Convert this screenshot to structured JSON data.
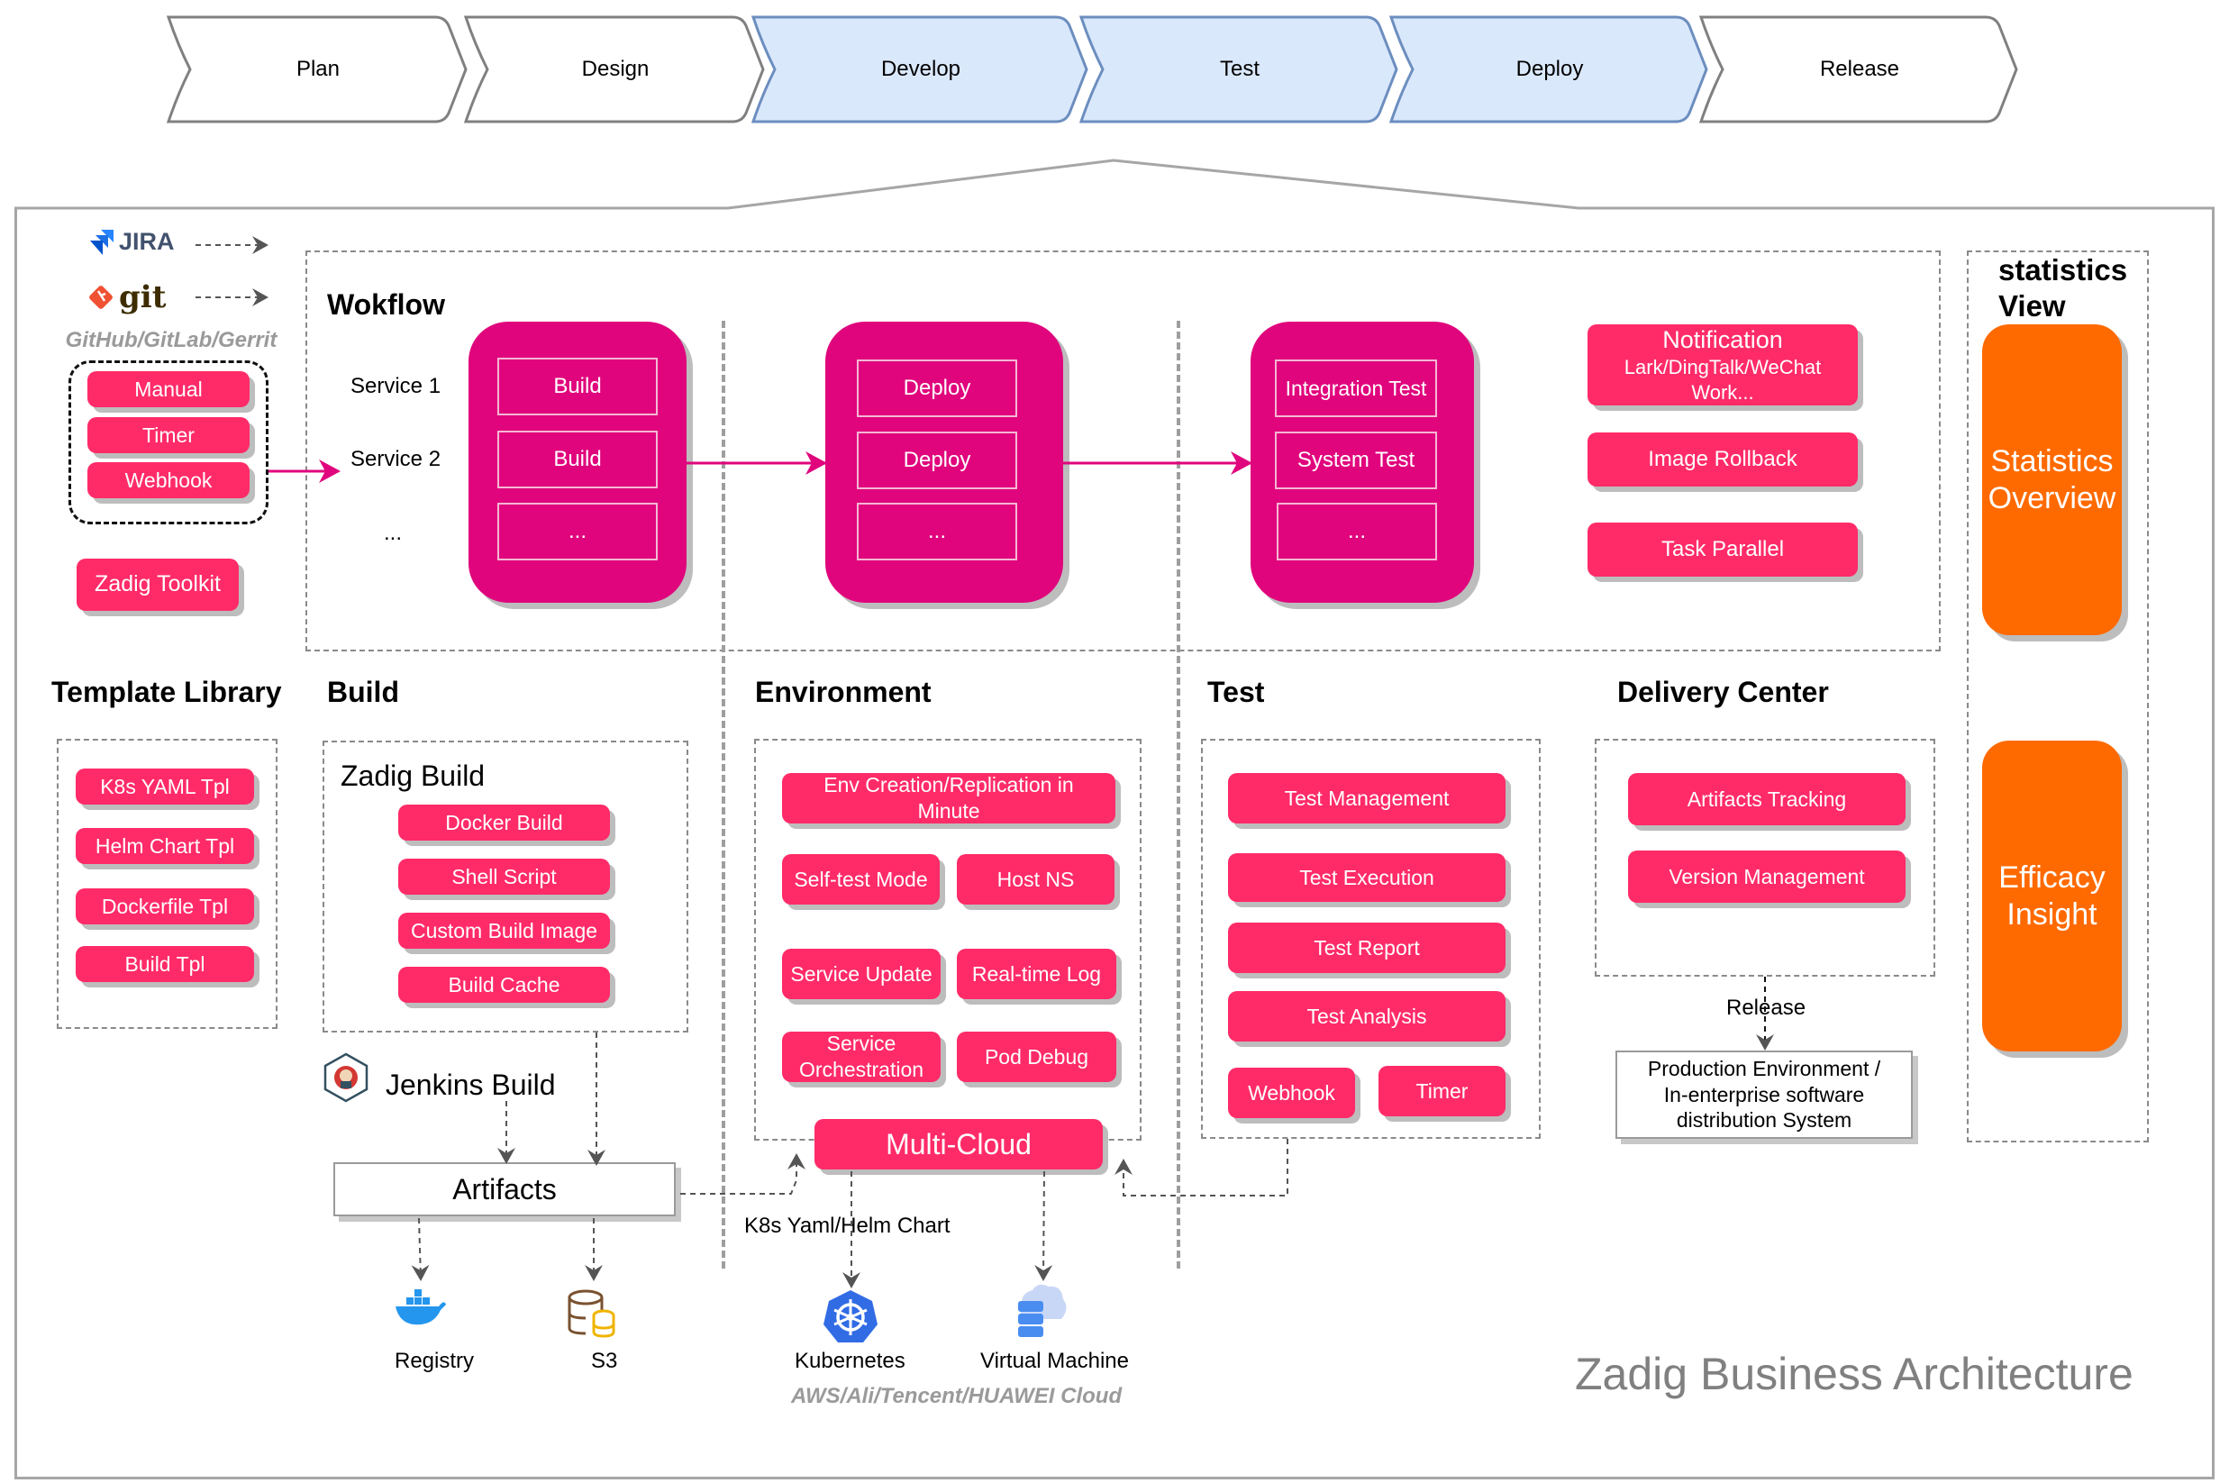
{
  "lifecycle": {
    "stages": [
      {
        "label": "Plan",
        "active": false
      },
      {
        "label": "Design",
        "active": false
      },
      {
        "label": "Develop",
        "active": true
      },
      {
        "label": "Test",
        "active": true
      },
      {
        "label": "Deploy",
        "active": true
      },
      {
        "label": "Release",
        "active": false
      }
    ],
    "active_fill": "#dae8fc",
    "active_stroke": "#6c8ebf",
    "inactive_stroke": "#808080"
  },
  "sources": {
    "jira_label": "JIRA",
    "git_label": "git",
    "git_hosts": "GitHub/GitLab/Gerrit"
  },
  "triggers": [
    "Manual",
    "Timer",
    "Webhook"
  ],
  "toolkit": "Zadig Toolkit",
  "workflow": {
    "title": "Wokflow",
    "services": [
      "Service 1",
      "Service 2",
      "..."
    ],
    "build_stage": [
      "Build",
      "Build",
      "..."
    ],
    "deploy_stage": [
      "Deploy",
      "Deploy",
      "..."
    ],
    "test_stage": [
      "Integration Test",
      "System Test",
      "..."
    ],
    "extras": {
      "notification_title": "Notification",
      "notification_sub": "Lark/DingTalk/WeChat Work...",
      "image_rollback": "Image Rollback",
      "task_parallel": "Task Parallel"
    }
  },
  "statistics": {
    "title": "statistics View",
    "items": [
      "Statistics Overview",
      "Efficacy Insight"
    ],
    "color": "#ff6a00"
  },
  "template_library": {
    "title": "Template Library",
    "items": [
      "K8s YAML Tpl",
      "Helm Chart Tpl",
      "Dockerfile Tpl",
      "Build Tpl"
    ]
  },
  "build": {
    "title": "Build",
    "zadig_build": "Zadig Build",
    "items": [
      "Docker Build",
      "Shell Script",
      "Custom Build Image",
      "Build Cache"
    ],
    "jenkins": "Jenkins Build",
    "artifacts": "Artifacts",
    "registry": "Registry",
    "s3": "S3"
  },
  "environment": {
    "title": "Environment",
    "items": [
      "Env Creation/Replication in Minute",
      "Self-test Mode",
      "Host NS",
      "Service Update",
      "Real-time Log",
      "Service Orchestration",
      "Pod Debug"
    ],
    "multicloud": "Multi-Cloud",
    "k8s_label": "K8s Yaml/Helm Chart",
    "kubernetes": "Kubernetes",
    "vm": "Virtual Machine",
    "clouds": "AWS/Ali/Tencent/HUAWEI Cloud"
  },
  "test": {
    "title": "Test",
    "items": [
      "Test Management",
      "Test Execution",
      "Test Report",
      "Test Analysis",
      "Webhook",
      "Timer"
    ]
  },
  "delivery": {
    "title": "Delivery Center",
    "items": [
      "Artifacts Tracking",
      "Version Management"
    ],
    "release_label": "Release",
    "production": "Production Environment / In-enterprise software distribution System"
  },
  "caption": "Zadig Business Architecture",
  "colors": {
    "pink": "#ff2b68",
    "magenta": "#e0057d",
    "arrow": "#e0057d",
    "dash": "#555555"
  }
}
